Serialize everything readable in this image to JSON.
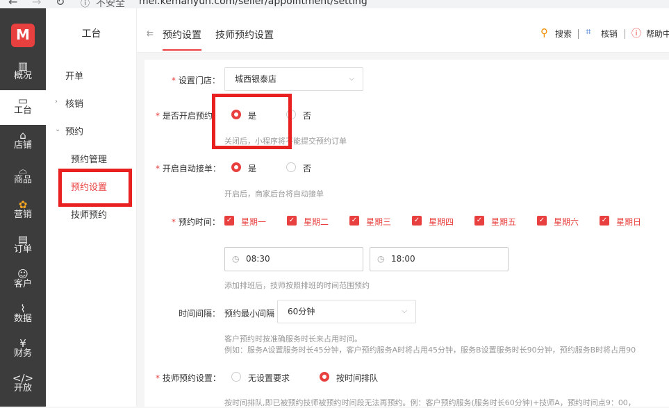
{
  "browser": {
    "url": "mei.kemanyun.com/seller/appointment/setting",
    "insecure": "不安全"
  },
  "sidebar": {
    "items": [
      {
        "label": "概况",
        "icon": "chart-icon"
      },
      {
        "label": "工台",
        "icon": "monitor-icon"
      },
      {
        "label": "店铺",
        "icon": "store-icon"
      },
      {
        "label": "商品",
        "icon": "bag-icon"
      },
      {
        "label": "营销",
        "icon": "marketing-icon"
      },
      {
        "label": "订单",
        "icon": "order-icon"
      },
      {
        "label": "客户",
        "icon": "user-icon"
      },
      {
        "label": "数据",
        "icon": "data-icon"
      },
      {
        "label": "财务",
        "icon": "finance-icon"
      },
      {
        "label": "开放",
        "icon": "code-icon"
      }
    ]
  },
  "subnav": {
    "title": "工台",
    "items": [
      "开单",
      "核销",
      "预约",
      "预约管理",
      "预约设置",
      "技师预约"
    ]
  },
  "header": {
    "tabs": [
      "预约设置",
      "技师预约设置"
    ],
    "search": "搜索",
    "verify": "核销",
    "help": "帮助中"
  },
  "form": {
    "store_label": "设置门店：",
    "store_value": "城西银泰店",
    "enable_label": "是否开启预约：",
    "yes": "是",
    "no": "否",
    "enable_hint": "关闭后，小程序将不能提交预约订单",
    "auto_label": "开启自动接单：",
    "auto_hint": "开启后，商家后台将自动接单",
    "time_label": "预约时间：",
    "days": [
      "星期一",
      "星期二",
      "星期三",
      "星期四",
      "星期五",
      "星期六",
      "星期日"
    ],
    "start_time": "08:30",
    "end_time": "18:00",
    "time_hint": "添加排班后，技师按照排班的时间范围预约",
    "interval_label": "时间间隔：",
    "interval_prefix": "预约最小间隔",
    "interval_value": "60分钟",
    "interval_hint1": "客户预约时按准确服务时长来占用时间。",
    "interval_hint2": "例如：服务A设置服务时长45分钟，客户预约服务A时将占用45分钟，服务B设置服务时长90分钟，预约服务B时将占用90",
    "tech_label": "技师预约设置：",
    "tech_opt1": "无设置要求",
    "tech_opt2": "按时间排队",
    "tech_hint": "按时间排队,即已被预约技师被预约时间段无法再预约。例：客户预约服务(服务时长60分钟)+技师A，预约时间点9：00，"
  }
}
